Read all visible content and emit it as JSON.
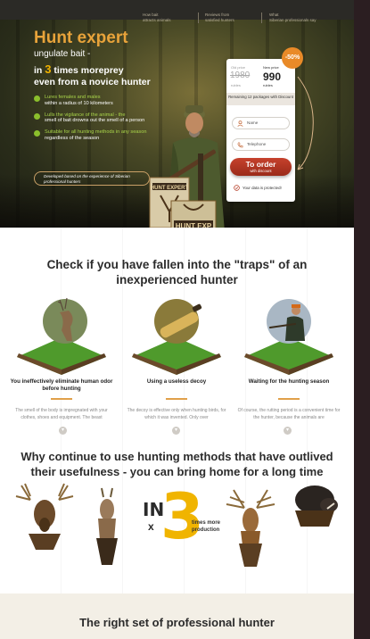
{
  "nav": [
    {
      "line1": "How bait",
      "line2": "attracts animals"
    },
    {
      "line1": "Reviews from",
      "line2": "satisfied hunters"
    },
    {
      "line1": "What",
      "line2": "Siberian professionals say"
    }
  ],
  "hero": {
    "title": "Hunt expert",
    "subtitle": "ungulate bait -",
    "headline_pre": "in ",
    "headline_num": "3",
    "headline_mid": " times moreprey",
    "headline_post": "even from a novice hunter",
    "bullets": [
      {
        "highlight": "Lures females and males",
        "rest": "within a radius of 10 kilometers"
      },
      {
        "highlight": "Lulls the vigilance of the animal - the",
        "rest": "smell of bait drowns out the smell of a person"
      },
      {
        "highlight": "Suitable for all hunting methods in any season",
        "rest": "regardless of the season"
      }
    ],
    "developed": "Developed based on the experience of Siberian professional hunters"
  },
  "order": {
    "discount": "-50%",
    "old_label": "Old price",
    "old_price": "1980",
    "old_currency": "rubles",
    "new_label": "New price",
    "new_price": "990",
    "new_currency": "rubles",
    "remaining": "Remaining 12 packages with Discount",
    "name_placeholder": "Name",
    "phone_placeholder": "Telephone",
    "button_main": "To order",
    "button_sub": "with discount",
    "protected": "Your data is protected!"
  },
  "traps": {
    "title": "Check if you have fallen into the \"traps\" of an inexperienced hunter",
    "items": [
      {
        "caption": "You ineffectively eliminate human odor before hunting",
        "desc": "The smell of the body is impregnated with your clothes, shoes and equipment. The beast"
      },
      {
        "caption": "Using a useless decoy",
        "desc": "The decoy is effective only when hunting birds, for which it was invented. Only over"
      },
      {
        "caption": "Waiting for the hunting season",
        "desc": "Of course, the rutting period is a convenient time for the hunter, because the animals are"
      }
    ]
  },
  "methods": {
    "title": "Why continue to use hunting methods that have outlived their usefulness - you can bring home for a long time",
    "in_label": "IN",
    "x_label": "x",
    "big_num": "3",
    "times_text": "times more production"
  },
  "set": {
    "title": "The right set of professional hunter"
  },
  "colors": {
    "accent_orange": "#e8a33a",
    "accent_green": "#8bbf2c",
    "order_red": "#b3361f",
    "yellow": "#f0b400"
  }
}
